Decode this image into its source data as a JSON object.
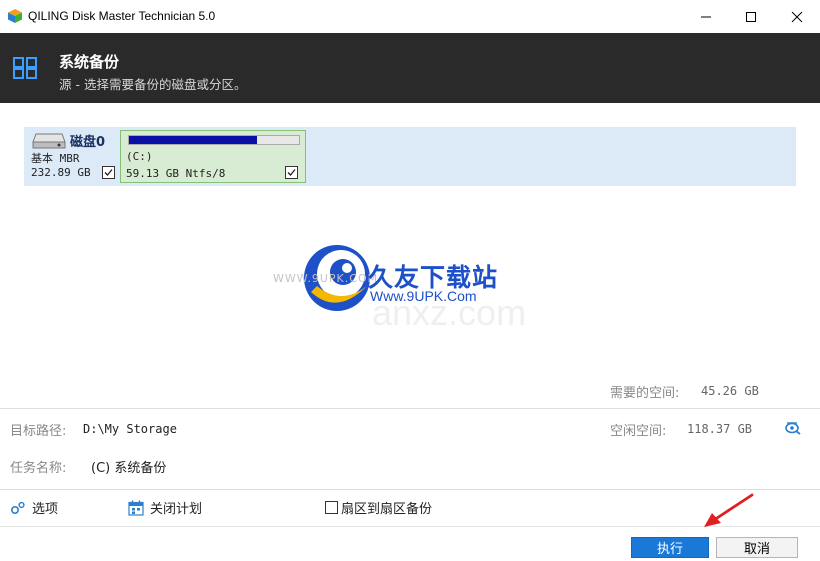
{
  "window": {
    "title": "QILING Disk Master Technician 5.0"
  },
  "header": {
    "title": "系统备份",
    "subtitle": "源 - 选择需要备份的磁盘或分区。"
  },
  "disk": {
    "name": "磁盘0",
    "type": "基本 MBR",
    "size": "232.89 GB",
    "checked": true,
    "partition": {
      "label": "(C:)",
      "info": "59.13 GB Ntfs/8",
      "used_fraction": 0.75,
      "checked": true
    }
  },
  "watermark": {
    "www_text": "WWW.9UPK.COM",
    "brand": "久友下载站",
    "url": "Www.9UPK.Com",
    "ghost": "anxz.com"
  },
  "space": {
    "required_label": "需要的空间:",
    "required_value": "45.26 GB",
    "free_label": "空闲空间:",
    "free_value": "118.37 GB"
  },
  "target": {
    "label": "目标路径:",
    "path": "D:\\My Storage"
  },
  "task": {
    "label": "任务名称:",
    "name": "(C) 系统备份"
  },
  "options": {
    "options_label": "选项",
    "schedule_label": "关闭计划",
    "sector_label": "扇区到扇区备份",
    "sector_checked": false
  },
  "buttons": {
    "run": "执行",
    "cancel": "取消"
  },
  "colors": {
    "header_bg": "#2a2a2a",
    "accent": "#1a78d6",
    "partition_fill": "#0a0fa8",
    "disk_row_bg": "#dceaf7",
    "partition_bg": "#d7ecd2",
    "arrow": "#e02020"
  }
}
